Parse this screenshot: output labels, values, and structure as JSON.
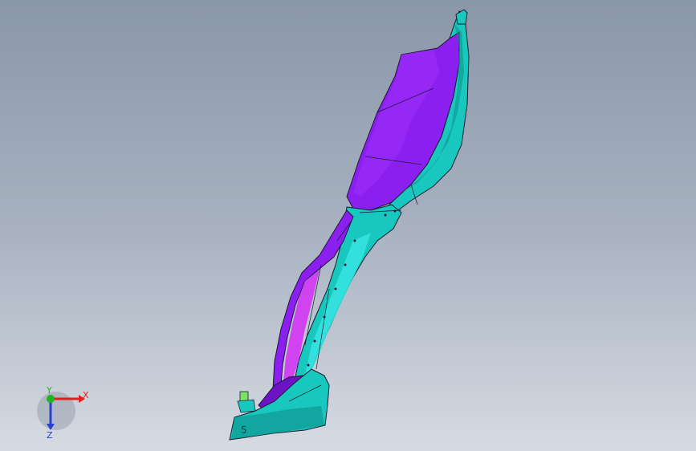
{
  "viewport": {
    "background_top": "#8a97a9",
    "background_bottom": "#d6dbe3"
  },
  "model": {
    "colors": {
      "purple": "#8b1ff0",
      "purple_dark": "#6d12c4",
      "magenta": "#d23cf2",
      "teal": "#18c7bd",
      "teal_dark": "#0e8f8a",
      "outline": "#1a1a2e"
    },
    "part_label": "5"
  },
  "triad": {
    "x_label": "X",
    "y_label": "Y",
    "z_label": "Z",
    "x_color": "#e0201c",
    "y_color": "#1fb51f",
    "z_color": "#2a3fd6"
  }
}
